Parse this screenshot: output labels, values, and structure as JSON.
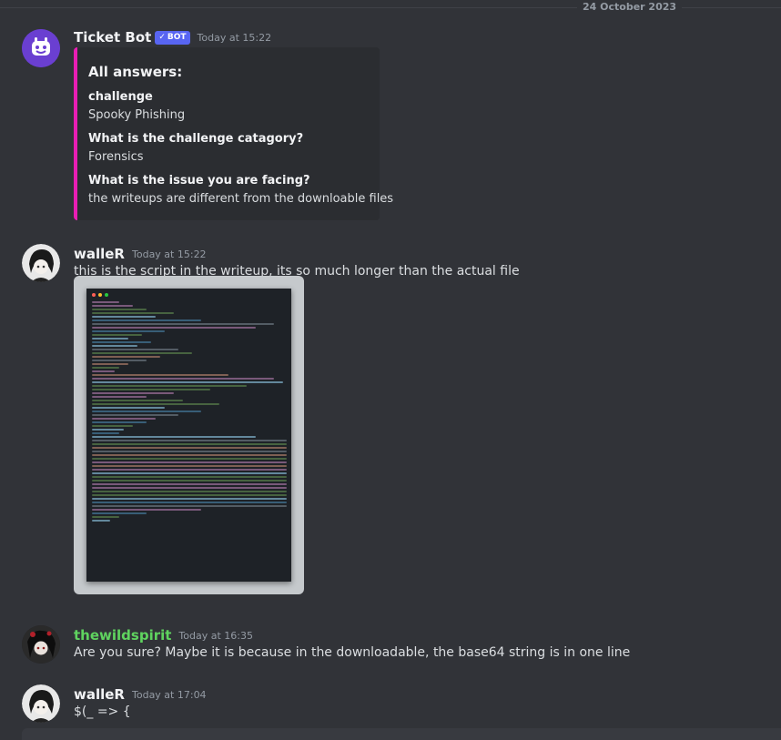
{
  "date_divider": "24 October 2023",
  "messages": [
    {
      "author": "Ticket Bot",
      "bot_tag": "BOT",
      "timestamp": "Today at 15:22",
      "avatar": "bot-avatar-icon",
      "embed": {
        "accent": "#e91eb4",
        "title": "All answers:",
        "fields": [
          {
            "name": "challenge",
            "value": "Spooky Phishing"
          },
          {
            "name": "What is the challenge catagory?",
            "value": "Forensics"
          },
          {
            "name": "What is the issue you are facing?",
            "value": "the writeups are different from the downloable files"
          }
        ]
      }
    },
    {
      "author": "walleR",
      "timestamp": "Today at 15:22",
      "text": "this is the script in the writeup, its so much longer than the actual file",
      "attachment": "code-screenshot-image"
    },
    {
      "author": "thewildspirit",
      "author_color": "#5fd35f",
      "timestamp": "Today at 16:35",
      "text": "Are you sure? Maybe it is because in the downloadable, the base64 string is in one line"
    },
    {
      "author": "walleR",
      "timestamp": "Today at 17:04",
      "text": "$(_ => {"
    }
  ]
}
